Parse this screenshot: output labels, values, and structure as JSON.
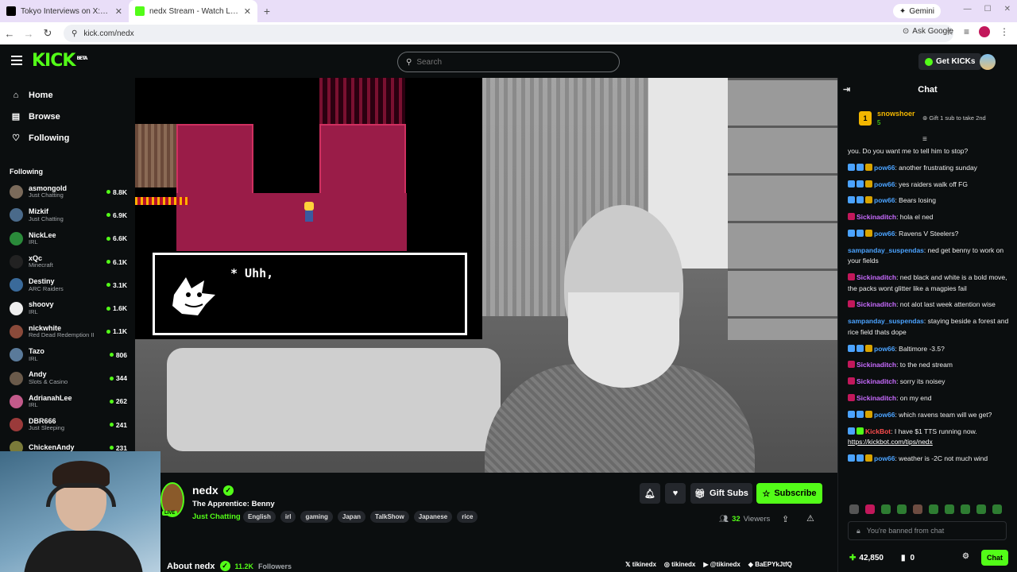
{
  "browser": {
    "tabs": [
      {
        "title": "Tokyo Interviews on X: \"@callin",
        "favicon_color": "#000000",
        "close": "✕"
      },
      {
        "title": "nedx Stream - Watch Live o",
        "favicon_color": "#53fc18",
        "close": "✕"
      }
    ],
    "new_tab": "+",
    "gemini_label": "Gemini",
    "url": "kick.com/nedx",
    "ask_google": "Ask Google"
  },
  "header": {
    "logo": "KICK",
    "logo_badge": "BETA",
    "search_placeholder": "Search",
    "get_kicks_label": "Get KICKs"
  },
  "sidebar": {
    "nav": [
      {
        "label": "Home",
        "icon": "home-icon",
        "glyph": "⌂"
      },
      {
        "label": "Browse",
        "icon": "browse-icon",
        "glyph": "▤"
      },
      {
        "label": "Following",
        "icon": "heart-icon",
        "glyph": "♡"
      }
    ],
    "following_heading": "Following",
    "following": [
      {
        "name": "asmongold",
        "category": "Just Chatting",
        "viewers": "8.8K",
        "color": "#7a6a5a"
      },
      {
        "name": "Mizkif",
        "category": "Just Chatting",
        "viewers": "6.9K",
        "color": "#4a6a8a"
      },
      {
        "name": "NickLee",
        "category": "IRL",
        "viewers": "6.6K",
        "color": "#2a8a3a"
      },
      {
        "name": "xQc",
        "category": "Minecraft",
        "viewers": "6.1K",
        "color": "#222222"
      },
      {
        "name": "Destiny",
        "category": "ARC Raiders",
        "viewers": "3.1K",
        "color": "#3a6a9a"
      },
      {
        "name": "shoovy",
        "category": "IRL",
        "viewers": "1.6K",
        "color": "#eeeeee"
      },
      {
        "name": "nickwhite",
        "category": "Red Dead Redemption II",
        "viewers": "1.1K",
        "color": "#8a4a3a"
      },
      {
        "name": "Tazo",
        "category": "IRL",
        "viewers": "806",
        "color": "#5a7a9a"
      },
      {
        "name": "Andy",
        "category": "Slots & Casino",
        "viewers": "344",
        "color": "#6a5a4a"
      },
      {
        "name": "AdrianahLee",
        "category": "IRL",
        "viewers": "262",
        "color": "#c25a8a"
      },
      {
        "name": "DBR666",
        "category": "Just Sleeping",
        "viewers": "241",
        "color": "#9a3a3a"
      },
      {
        "name": "ChickenAndy",
        "category": "",
        "viewers": "231",
        "color": "#7a7a3a"
      }
    ]
  },
  "game": {
    "dialog_text": "* Uhh,"
  },
  "stream": {
    "streamer": "nedx",
    "live_label": "LIVE",
    "title": "The Apprentice: Benny",
    "category": "Just Chatting",
    "tags": [
      "English",
      "irl",
      "gaming",
      "Japan",
      "TalkShow",
      "Japanese",
      "rice"
    ],
    "gift_subs_label": "Gift Subs",
    "subscribe_label": "Subscribe",
    "viewers": "32",
    "viewers_label": "Viewers",
    "about_label": "About nedx",
    "followers_count": "11.2K",
    "followers_label": "Followers",
    "socials": [
      {
        "icon": "x-icon",
        "glyph": "𝕏",
        "handle": "tikinedx"
      },
      {
        "icon": "instagram-icon",
        "glyph": "◎",
        "handle": "tikinedx"
      },
      {
        "icon": "youtube-icon",
        "glyph": "▶",
        "handle": "@tikinedx"
      },
      {
        "icon": "discord-icon",
        "glyph": "◆",
        "handle": "BaEPYkJtfQ"
      }
    ]
  },
  "chat": {
    "title": "Chat",
    "pinned": {
      "rank": "1",
      "name": "snowshoer",
      "count": "5",
      "gift_text": "Gift 1 sub to take 2nd"
    },
    "messages": [
      {
        "user": "",
        "color": "#ffffff",
        "text": "you. Do you want me to tell him to stop?",
        "badges": []
      },
      {
        "user": "pow66",
        "color": "#4ba3ff",
        "text": ": another frustrating sunday",
        "badges": [
          "#4ba3ff",
          "#4ba3ff",
          "#d9a400"
        ]
      },
      {
        "user": "pow66",
        "color": "#4ba3ff",
        "text": ": yes raiders walk off FG",
        "badges": [
          "#4ba3ff",
          "#4ba3ff",
          "#d9a400"
        ]
      },
      {
        "user": "pow66",
        "color": "#4ba3ff",
        "text": ": Bears losing",
        "badges": [
          "#4ba3ff",
          "#4ba3ff",
          "#d9a400"
        ]
      },
      {
        "user": "Sickinaditch",
        "color": "#c86bff",
        "text": ": hola el ned",
        "badges": [
          "#c2185b"
        ]
      },
      {
        "user": "pow66",
        "color": "#4ba3ff",
        "text": ": Ravens V Steelers?",
        "badges": [
          "#4ba3ff",
          "#4ba3ff",
          "#d9a400"
        ]
      },
      {
        "user": "sampanday_suspendas",
        "color": "#4ba3ff",
        "text": ": ned get benny to work on your fields",
        "badges": []
      },
      {
        "user": "Sickinaditch",
        "color": "#c86bff",
        "text": ": ned black and white is a bold move, the packs wont glitter like a magpies fail",
        "badges": [
          "#c2185b"
        ]
      },
      {
        "user": "Sickinaditch",
        "color": "#c86bff",
        "text": ": not alot last week attention wise",
        "badges": [
          "#c2185b"
        ]
      },
      {
        "user": "sampanday_suspendas",
        "color": "#4ba3ff",
        "text": ": staying beside a forest and rice field thats dope",
        "badges": []
      },
      {
        "user": "pow66",
        "color": "#4ba3ff",
        "text": ": Baltimore -3.5?",
        "badges": [
          "#4ba3ff",
          "#4ba3ff",
          "#d9a400"
        ]
      },
      {
        "user": "Sickinaditch",
        "color": "#c86bff",
        "text": ": to the ned stream",
        "badges": [
          "#c2185b"
        ]
      },
      {
        "user": "Sickinaditch",
        "color": "#c86bff",
        "text": ": sorry its noisey",
        "badges": [
          "#c2185b"
        ]
      },
      {
        "user": "Sickinaditch",
        "color": "#c86bff",
        "text": ": on my end",
        "badges": [
          "#c2185b"
        ]
      },
      {
        "user": "pow66",
        "color": "#4ba3ff",
        "text": ": which ravens team will we get?",
        "badges": [
          "#4ba3ff",
          "#4ba3ff",
          "#d9a400"
        ]
      },
      {
        "user": "KickBot",
        "color": "#ff4d4d",
        "text": ": I have $1 TTS running now.",
        "link": "https://kickbot.com/tips/nedx",
        "badges": [
          "#4ba3ff",
          "#53fc18"
        ]
      },
      {
        "user": "pow66",
        "color": "#4ba3ff",
        "text": ": weather is -2C not much wind",
        "badges": [
          "#4ba3ff",
          "#4ba3ff",
          "#d9a400"
        ]
      }
    ],
    "banned_placeholder": "You're banned from chat",
    "points": "42,850",
    "subs": "0",
    "send_label": "Chat"
  },
  "colors": {
    "accent": "#53fc18",
    "bg": "#0b0e0f",
    "panel": "#24272c"
  }
}
